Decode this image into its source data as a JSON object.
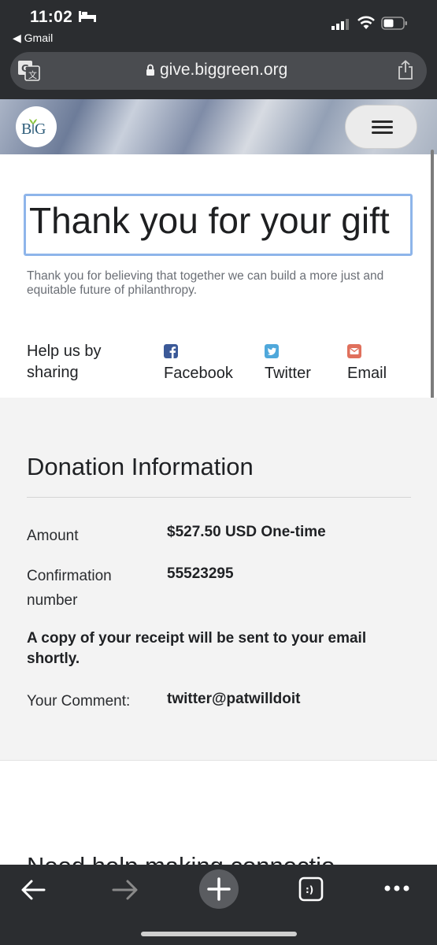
{
  "status_bar": {
    "time": "11:02",
    "back_app": "◀ Gmail"
  },
  "browser": {
    "url": "give.biggreen.org"
  },
  "header": {
    "logo_text": "BIG"
  },
  "page": {
    "title": "Thank you for your gift",
    "subtitle": "Thank you for believing that together we can build a more just and equitable future of philanthropy."
  },
  "share": {
    "label": "Help us by sharing",
    "links": [
      {
        "label": "Facebook",
        "icon": "facebook-icon",
        "color": "#3b5998"
      },
      {
        "label": "Twitter",
        "icon": "twitter-icon",
        "color": "#4fa8db"
      },
      {
        "label": "Email",
        "icon": "email-icon",
        "color": "#e0705c"
      }
    ]
  },
  "donation": {
    "heading": "Donation Information",
    "amount_label": "Amount",
    "amount_value": "$527.50 USD One-time",
    "confirmation_label": "Confirmation number",
    "confirmation_value": "55523295",
    "receipt_notice": "A copy of your receipt will be sent to your email shortly.",
    "comment_label": "Your Comment:",
    "comment_value": "twitter@patwilldoit"
  },
  "next_section": {
    "heading_partial": "Need help making connectio"
  },
  "colors": {
    "chrome": "#2b2d30",
    "focus_ring": "#8eb5ea",
    "panel": "#f3f3f3"
  }
}
